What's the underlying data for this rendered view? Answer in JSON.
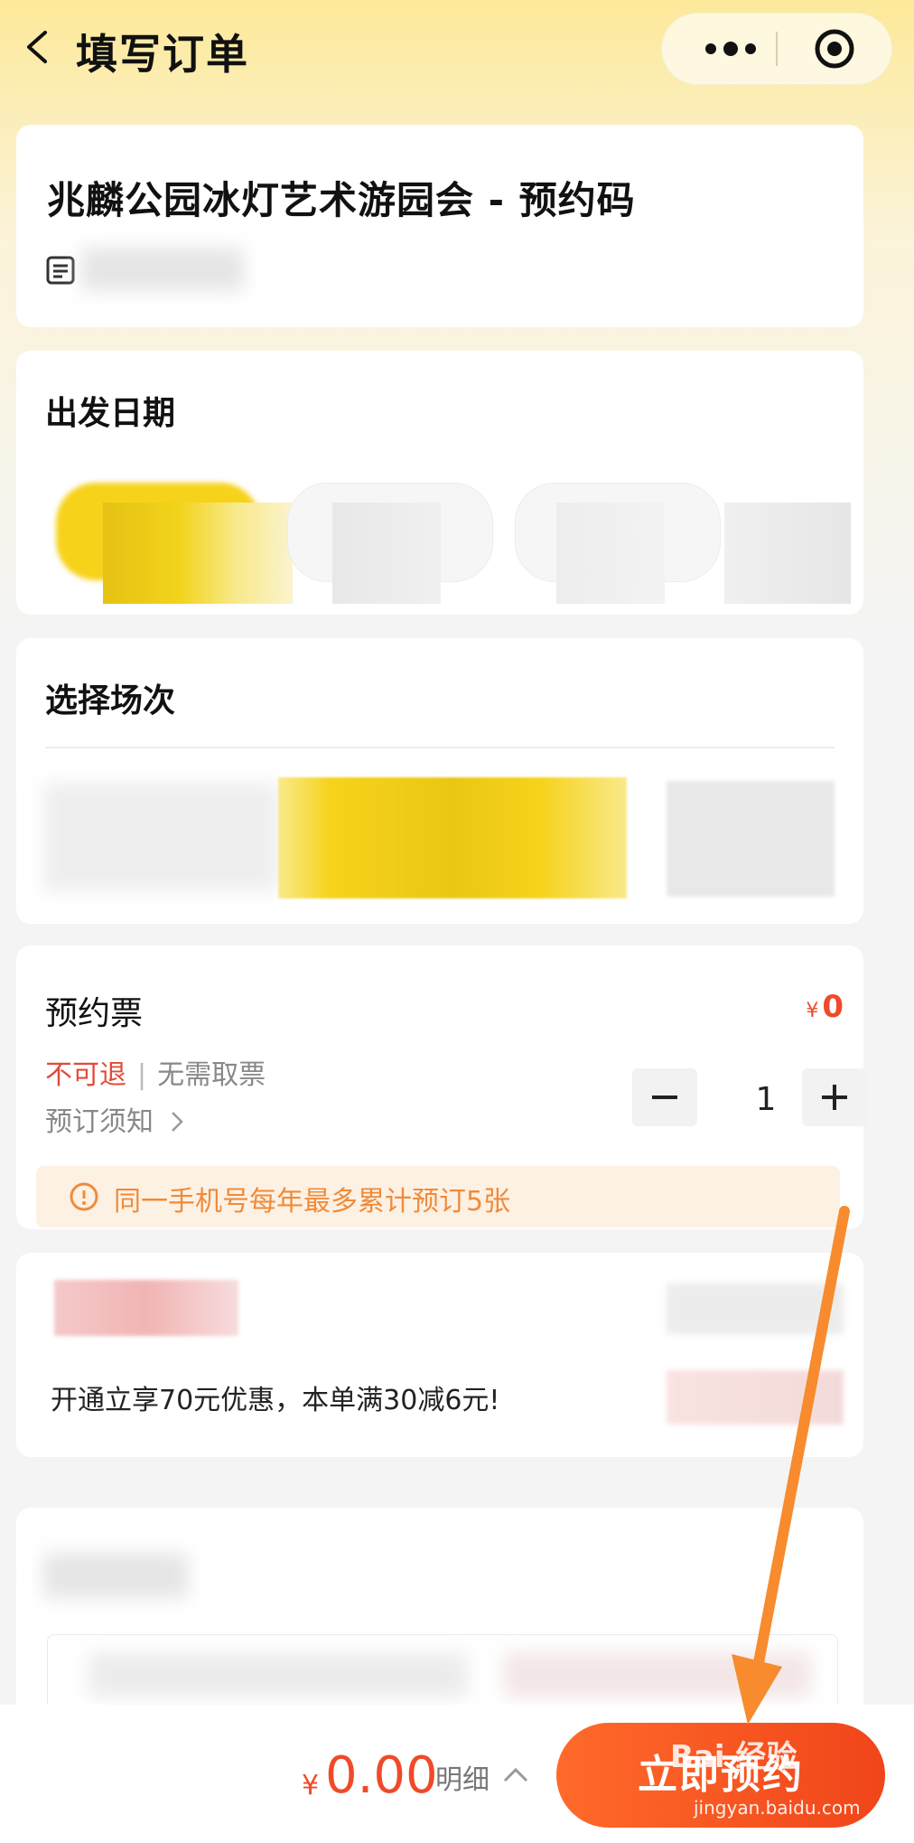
{
  "header": {
    "title": "填写订单"
  },
  "product": {
    "name": "兆麟公园冰灯艺术游园会 - 预约码"
  },
  "date_section": {
    "title": "出发日期"
  },
  "session_section": {
    "title": "选择场次"
  },
  "ticket": {
    "name": "预约票",
    "currency": "¥",
    "price": "0",
    "tag_refund": "不可退",
    "tag_pickup": "无需取票",
    "notice_label": "预订须知",
    "quantity": "1",
    "limit_notice": "同一手机号每年最多累计预订5张"
  },
  "promo": {
    "text": "开通立享70元优惠，本单满30减6元!"
  },
  "footer": {
    "currency": "¥",
    "total": "0.00",
    "detail_label": "明细",
    "book_label": "立即预约"
  },
  "watermark": {
    "brand": "Bai 经验",
    "url": "jingyan.baidu.com"
  },
  "colors": {
    "accent_orange": "#f04a2a",
    "warning_orange": "#ef8b3c",
    "highlight_yellow": "#f7d21b",
    "annotation_arrow": "#f78b2e"
  }
}
